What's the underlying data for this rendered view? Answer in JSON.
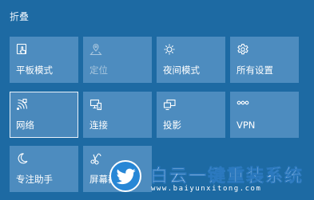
{
  "panel": {
    "collapse_label": "折叠"
  },
  "tiles": [
    {
      "label": "平板模式",
      "icon": "tablet-mode-icon",
      "state": "normal"
    },
    {
      "label": "定位",
      "icon": "location-icon",
      "state": "disabled"
    },
    {
      "label": "夜间模式",
      "icon": "night-light-icon",
      "state": "normal"
    },
    {
      "label": "所有设置",
      "icon": "gear-icon",
      "state": "normal"
    },
    {
      "label": "网络",
      "icon": "network-icon",
      "state": "focused"
    },
    {
      "label": "连接",
      "icon": "connect-icon",
      "state": "normal"
    },
    {
      "label": "投影",
      "icon": "project-icon",
      "state": "normal"
    },
    {
      "label": "VPN",
      "icon": "vpn-icon",
      "state": "normal"
    },
    {
      "label": "专注助手",
      "icon": "focus-assist-icon",
      "state": "normal"
    },
    {
      "label": "屏幕截",
      "icon": "screen-snip-icon",
      "state": "normal"
    }
  ],
  "watermark": {
    "title": "白云一键重装系统",
    "url": "www.baiyunxitong.com",
    "icon": "bird-icon"
  }
}
